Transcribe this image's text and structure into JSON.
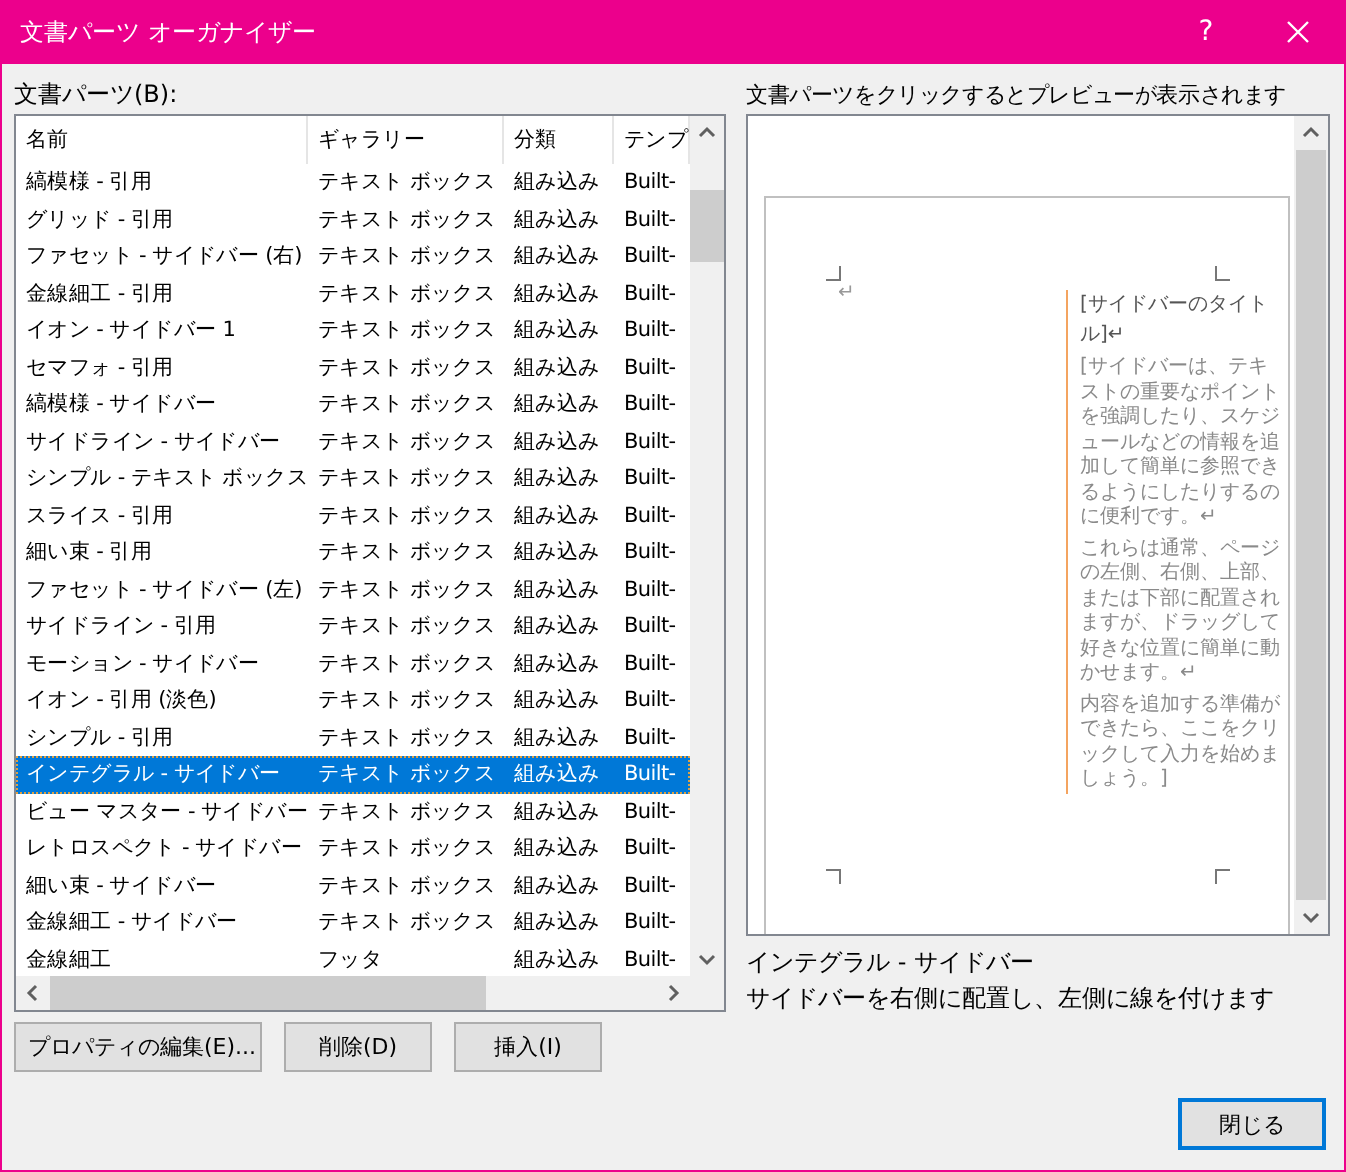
{
  "window": {
    "title": "文書パーツ オーガナイザー",
    "help": "?"
  },
  "parts_label": "文書パーツ(B):",
  "table": {
    "columns": [
      "名前",
      "ギャラリー",
      "分類",
      "テンプ"
    ],
    "rows": [
      {
        "cells": [
          "縞模様 - 引用",
          "テキスト ボックス",
          "組み込み",
          "Built-"
        ],
        "selected": false
      },
      {
        "cells": [
          "グリッド - 引用",
          "テキスト ボックス",
          "組み込み",
          "Built-"
        ],
        "selected": false
      },
      {
        "cells": [
          "ファセット - サイドバー (右)",
          "テキスト ボックス",
          "組み込み",
          "Built-"
        ],
        "selected": false
      },
      {
        "cells": [
          "金線細工 - 引用",
          "テキスト ボックス",
          "組み込み",
          "Built-"
        ],
        "selected": false
      },
      {
        "cells": [
          "イオン - サイドバー 1",
          "テキスト ボックス",
          "組み込み",
          "Built-"
        ],
        "selected": false
      },
      {
        "cells": [
          "セマフォ - 引用",
          "テキスト ボックス",
          "組み込み",
          "Built-"
        ],
        "selected": false
      },
      {
        "cells": [
          "縞模様 - サイドバー",
          "テキスト ボックス",
          "組み込み",
          "Built-"
        ],
        "selected": false
      },
      {
        "cells": [
          "サイドライン - サイドバー",
          "テキスト ボックス",
          "組み込み",
          "Built-"
        ],
        "selected": false
      },
      {
        "cells": [
          " シンプル - テキスト ボックス",
          "テキスト ボックス",
          "組み込み",
          "Built-"
        ],
        "selected": false
      },
      {
        "cells": [
          "スライス - 引用",
          "テキスト ボックス",
          "組み込み",
          "Built-"
        ],
        "selected": false
      },
      {
        "cells": [
          "細い束 - 引用",
          "テキスト ボックス",
          "組み込み",
          "Built-"
        ],
        "selected": false
      },
      {
        "cells": [
          "ファセット - サイドバー (左)",
          "テキスト ボックス",
          "組み込み",
          "Built-"
        ],
        "selected": false
      },
      {
        "cells": [
          "サイドライン - 引用",
          "テキスト ボックス",
          "組み込み",
          "Built-"
        ],
        "selected": false
      },
      {
        "cells": [
          "モーション - サイドバー",
          "テキスト ボックス",
          "組み込み",
          "Built-"
        ],
        "selected": false
      },
      {
        "cells": [
          "イオン - 引用 (淡色)",
          "テキスト ボックス",
          "組み込み",
          "Built-"
        ],
        "selected": false
      },
      {
        "cells": [
          "シンプル - 引用",
          "テキスト ボックス",
          "組み込み",
          "Built-"
        ],
        "selected": false
      },
      {
        "cells": [
          "インテグラル - サイドバー",
          "テキスト ボックス",
          "組み込み",
          "Built-"
        ],
        "selected": true
      },
      {
        "cells": [
          "ビュー マスター - サイドバー",
          "テキスト ボックス",
          "組み込み",
          "Built-"
        ],
        "selected": false
      },
      {
        "cells": [
          "レトロスペクト - サイドバー",
          "テキスト ボックス",
          "組み込み",
          "Built-"
        ],
        "selected": false
      },
      {
        "cells": [
          "細い束 - サイドバー",
          "テキスト ボックス",
          "組み込み",
          "Built-"
        ],
        "selected": false
      },
      {
        "cells": [
          "金線細工 - サイドバー",
          "テキスト ボックス",
          "組み込み",
          "Built-"
        ],
        "selected": false
      },
      {
        "cells": [
          "金線細工",
          "フッタ",
          "組み込み",
          "Built-"
        ],
        "selected": false
      }
    ]
  },
  "buttons": [
    "プロパティの編集(E)...",
    "削除(D)",
    "挿入(I)"
  ],
  "preview": {
    "caption": "文書パーツをクリックするとプレビューが表示されます",
    "mark": "↵",
    "sidebar_title": "[サイドバーのタイトル]↵",
    "paragraphs": [
      "[サイドバーは、テキストの重要なポイントを強調したり、スケジュールなどの情報を追加して簡単に参照できるようにしたりするのに便利です。↵",
      "これらは通常、ページの左側、右側、上部、または下部に配置されますが、ドラッグして好きな位置に簡単に動かせます。↵",
      "内容を追加する準備ができたら、ここをクリックして入力を始めましょう。]"
    ]
  },
  "selected_part": {
    "name": "インテグラル - サイドバー",
    "description": "サイドバーを右側に配置し、左側に線を付けます"
  },
  "close_button": "閉じる"
}
